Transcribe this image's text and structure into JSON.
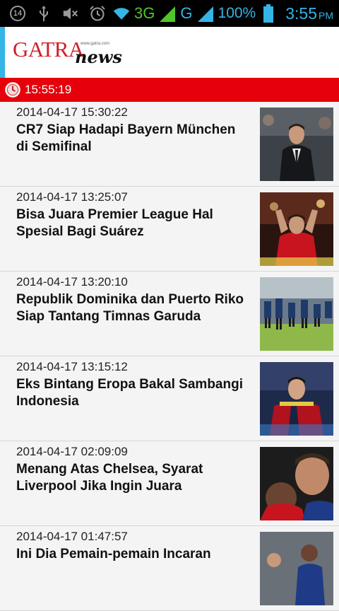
{
  "status_bar": {
    "notification_count": "14",
    "network_3g": "3G",
    "network_g": "G",
    "battery": "100%",
    "time": "3:55",
    "ampm": "PM"
  },
  "header": {
    "logo_main": "GATRA",
    "logo_sub": "news",
    "logo_small": "www.gatra.com"
  },
  "clock_bar": {
    "time": "15:55:19"
  },
  "articles": [
    {
      "date": "2014-04-17 15:30:22",
      "title": "CR7 Siap Hadapi Bayern München di Semifinal"
    },
    {
      "date": "2014-04-17 13:25:07",
      "title": "Bisa Juara Premier League Hal Spesial Bagi Suárez"
    },
    {
      "date": "2014-04-17 13:20:10",
      "title": "Republik Dominika dan Puerto Riko Siap Tantang Timnas Garuda"
    },
    {
      "date": "2014-04-17 13:15:12",
      "title": "Eks Bintang Eropa Bakal Sambangi Indonesia"
    },
    {
      "date": "2014-04-17 02:09:09",
      "title": "Menang Atas Chelsea, Syarat Liverpool Jika Ingin Juara"
    },
    {
      "date": "2014-04-17 01:47:57",
      "title": "Ini Dia Pemain-pemain Incaran"
    }
  ]
}
